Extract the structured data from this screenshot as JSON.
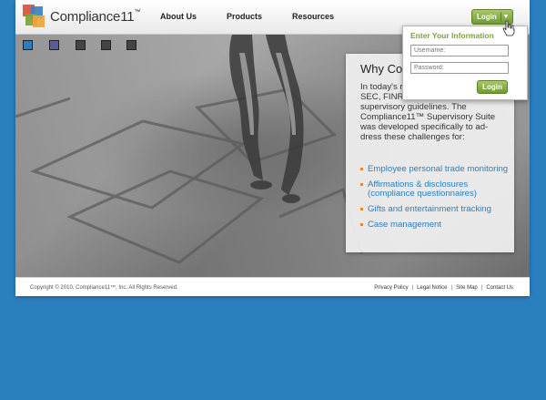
{
  "brand": {
    "name": "Compliance11",
    "trademark": "™",
    "logo_colors": [
      "#e24b3a",
      "#3d7fc2",
      "#7aa43a",
      "#f2a33a"
    ]
  },
  "nav": {
    "items": [
      "About Us",
      "Products",
      "Resources"
    ]
  },
  "header": {
    "login_label": "Login",
    "login_chevron_icon": "chevron-down-icon"
  },
  "login_panel": {
    "title": "Enter Your Information",
    "username_placeholder": "Username:",
    "password_placeholder": "Password:",
    "submit_label": "Login"
  },
  "slideshow": {
    "thumb_colors": [
      "#2a7ec0",
      "#5a5aa8",
      "#444444",
      "#444444",
      "#444444"
    ]
  },
  "why": {
    "title": "Why Co",
    "paragraph": "In today's r firms are c changing SEC, FINRA and CFTC supervisory guidelines. The Compliance11™ Supervisory Suite was developed specifically to ad-dress these challenges for:",
    "bullets": [
      "Employee personal trade monitoring",
      "Affirmations & disclosures (compliance questionnaires)",
      "Gifts and entertainment tracking",
      "Case management"
    ],
    "bullet_color": "#e8882b",
    "link_color": "#2a7ec0"
  },
  "footer": {
    "copyright": "Copyright © 2010, Compliance11™, Inc. All Rights Reserved.",
    "links": [
      "Privacy Policy",
      "Legal Notice",
      "Site Map",
      "Contact Us"
    ],
    "separator": "|"
  },
  "colors": {
    "background": "#2a80bf",
    "accent_green": "#78a53a"
  }
}
